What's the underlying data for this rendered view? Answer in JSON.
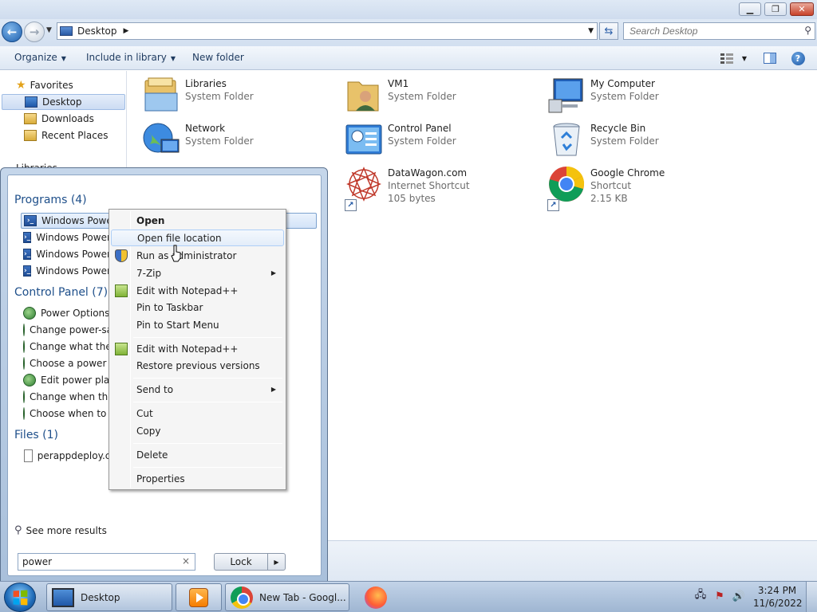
{
  "window": {
    "address": "Desktop",
    "search_placeholder": "Search Desktop",
    "controls": {
      "minimize": "▭",
      "maximize": "❐",
      "close": "✕"
    }
  },
  "toolbar": {
    "organize": "Organize",
    "include_in_library": "Include in library",
    "new_folder": "New folder"
  },
  "navpane": {
    "favorites": "Favorites",
    "items": [
      "Desktop",
      "Downloads",
      "Recent Places"
    ],
    "partial": "Libraries"
  },
  "content": {
    "tiles": [
      {
        "name": "Libraries",
        "sub": "System Folder",
        "icon": "libraries-icon"
      },
      {
        "name": "VM1",
        "sub": "System Folder",
        "icon": "user-folder-icon"
      },
      {
        "name": "My Computer",
        "sub": "System Folder",
        "icon": "computer-icon"
      },
      {
        "name": "Network",
        "sub": "System Folder",
        "icon": "network-icon"
      },
      {
        "name": "Control Panel",
        "sub": "System Folder",
        "icon": "control-panel-icon"
      },
      {
        "name": "Recycle Bin",
        "sub": "System Folder",
        "icon": "recycle-bin-icon"
      },
      {
        "name": "DataWagon.com",
        "sub": "Internet Shortcut",
        "sub2": "105 bytes",
        "icon": "internet-shortcut-icon"
      },
      {
        "name": "Google Chrome",
        "sub": "Shortcut",
        "sub2": "2.15 KB",
        "icon": "chrome-icon"
      }
    ]
  },
  "startmenu": {
    "programs_header": "Programs (4)",
    "programs": [
      "Windows PowerShell",
      "Windows PowerShell",
      "Windows PowerShell",
      "Windows PowerShell"
    ],
    "control_panel_header": "Control Panel (7)",
    "control_panel": [
      "Power Options",
      "Change power-saving settings",
      "Change what the power buttons do",
      "Choose a power plan",
      "Edit power plan",
      "Change when the computer sleeps",
      "Choose when to turn off display"
    ],
    "files_header": "Files (1)",
    "files": [
      "perappdeploy.cn"
    ],
    "see_more": "See more results",
    "search_value": "power",
    "clear": "×",
    "lock_label": "Lock"
  },
  "context_menu": {
    "items": [
      "Open",
      "Open file location",
      "Run as administrator",
      "7-Zip",
      "Edit with Notepad++",
      "Pin to Taskbar",
      "Pin to Start Menu",
      "Edit with Notepad++",
      "Restore previous versions",
      "Send to",
      "Cut",
      "Copy",
      "Delete",
      "Properties"
    ]
  },
  "taskbar": {
    "desktop": "Desktop",
    "chrome": "New Tab - Googl...",
    "time": "3:24 PM",
    "date": "11/6/2022"
  }
}
